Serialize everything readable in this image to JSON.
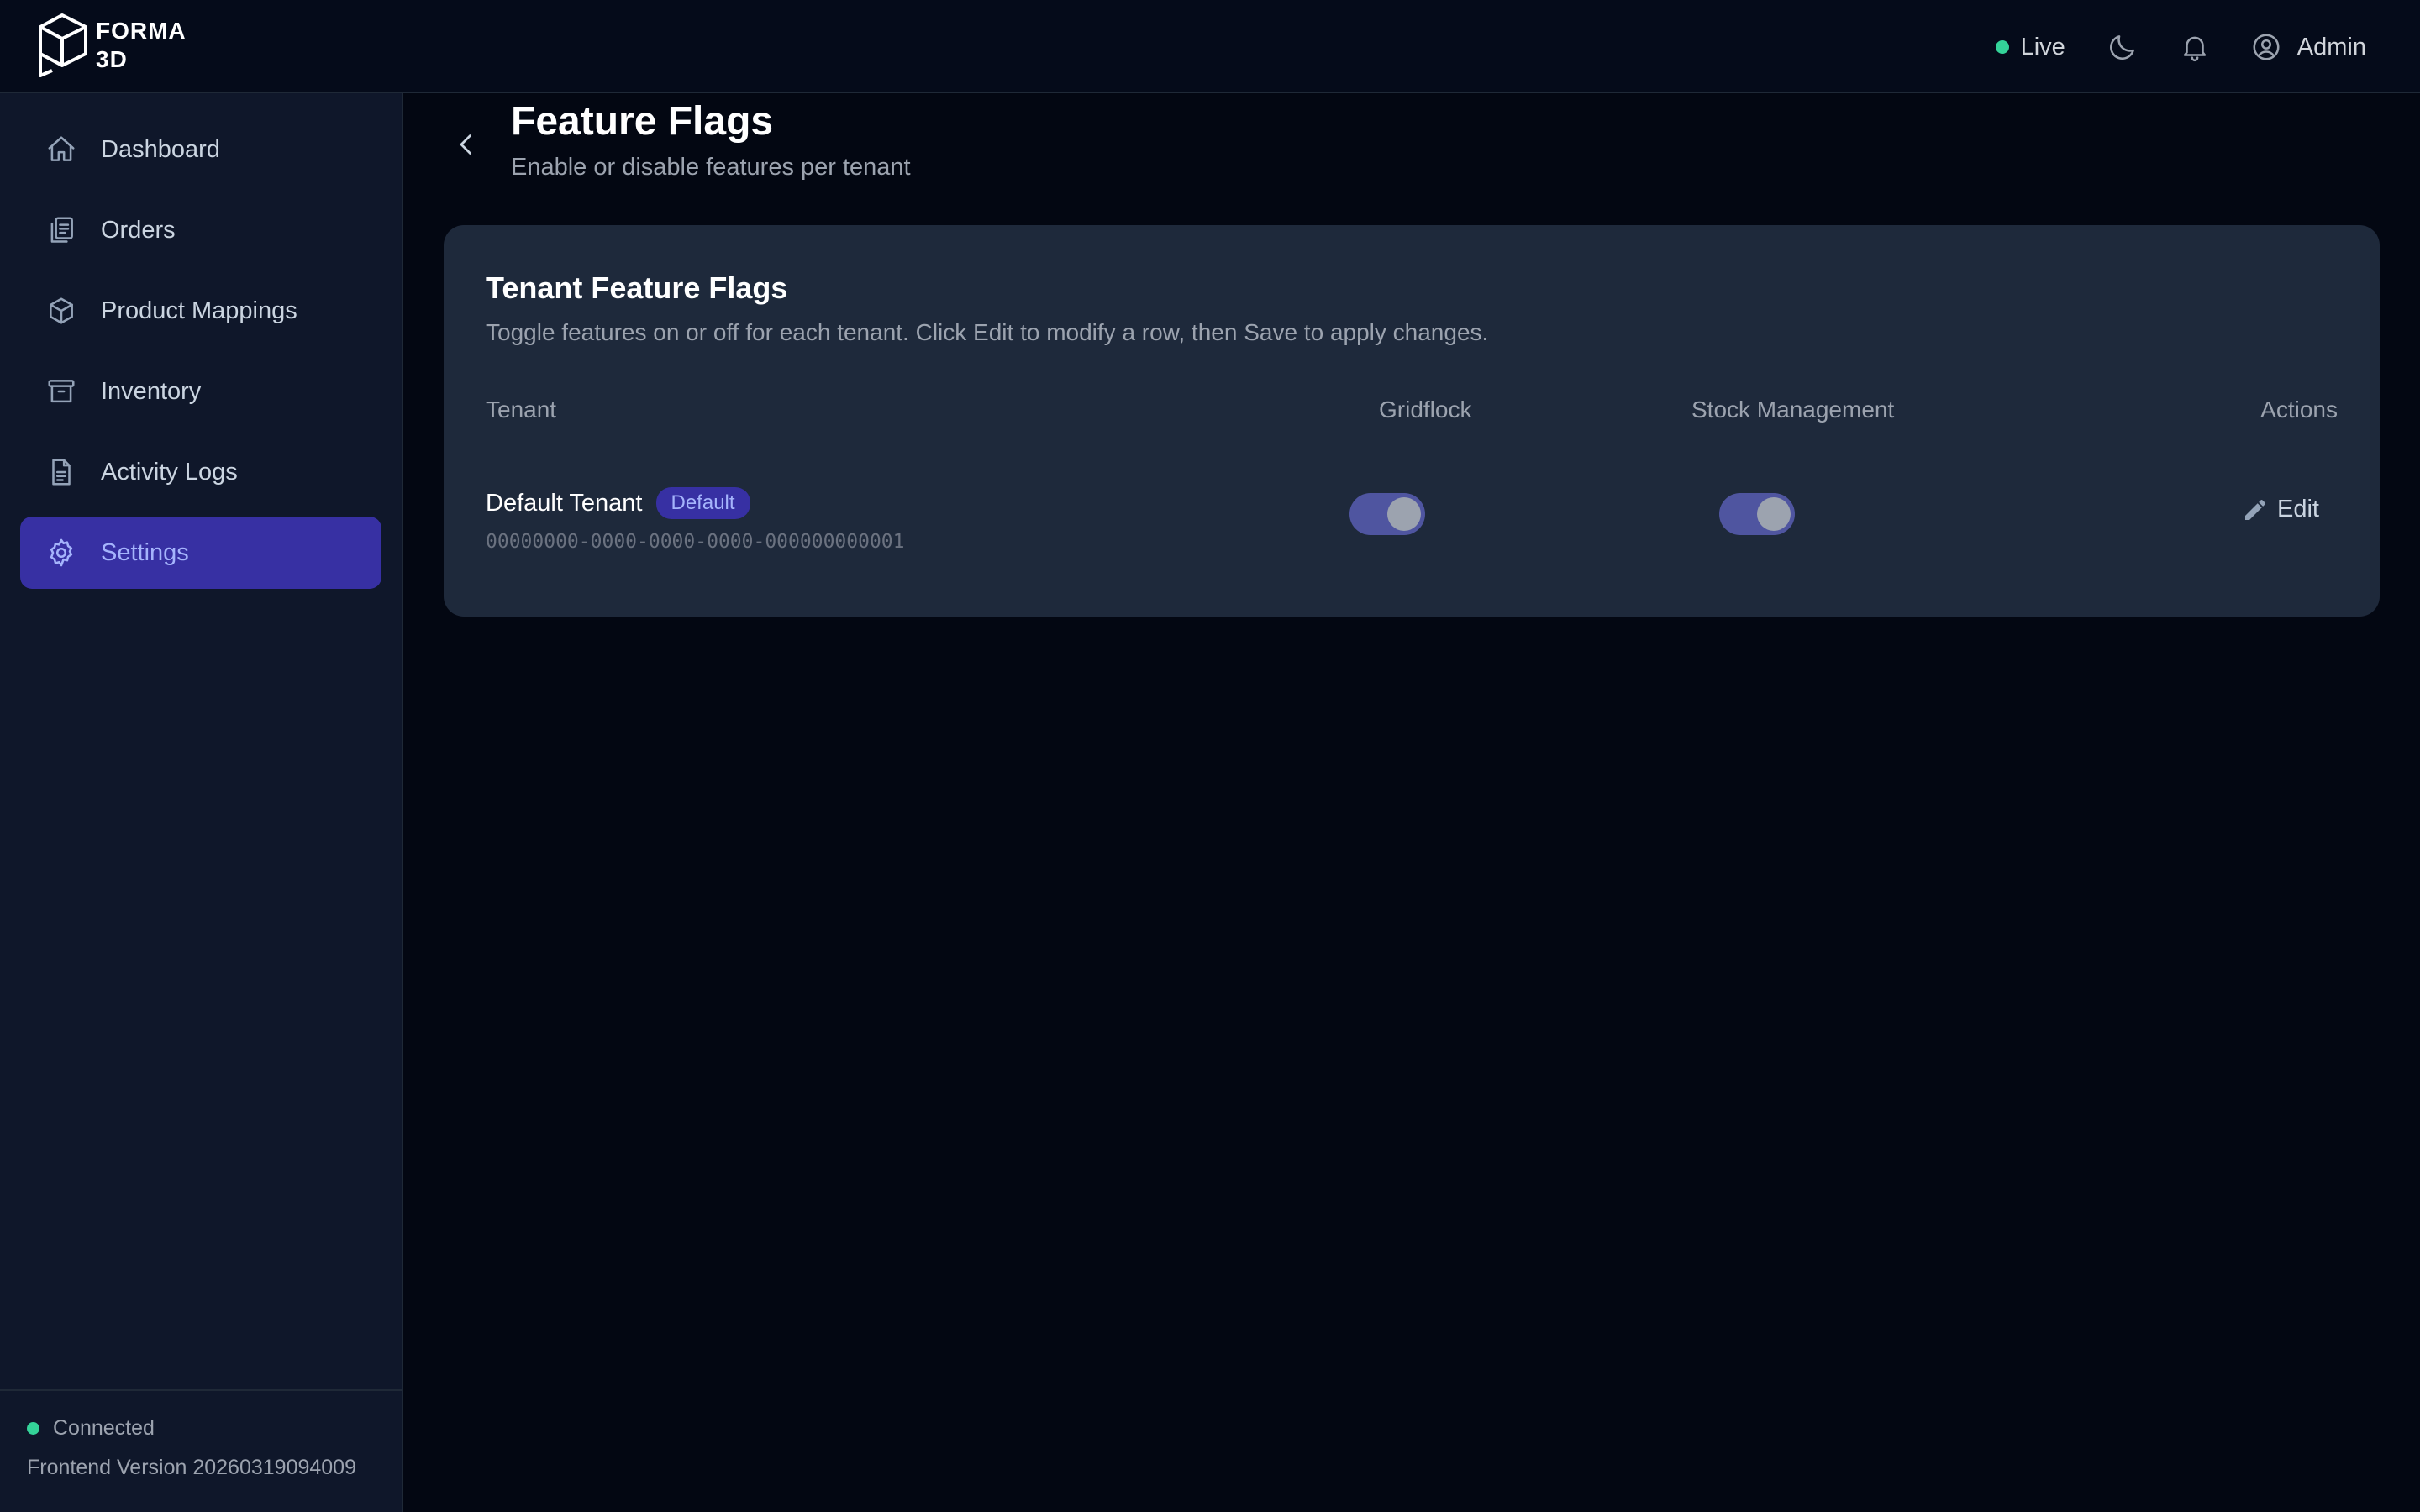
{
  "app": {
    "logo_line1": "FORMA",
    "logo_line2": "3D"
  },
  "header": {
    "status": "Live",
    "user": "Admin",
    "icons": [
      "moon-icon",
      "bell-icon",
      "user-circle-icon"
    ]
  },
  "sidebar": {
    "items": [
      {
        "label": "Dashboard",
        "icon": "home-icon"
      },
      {
        "label": "Orders",
        "icon": "clipboard-icon"
      },
      {
        "label": "Product Mappings",
        "icon": "cube-icon"
      },
      {
        "label": "Inventory",
        "icon": "archive-box-icon"
      },
      {
        "label": "Activity Logs",
        "icon": "document-icon"
      },
      {
        "label": "Settings",
        "icon": "gear-icon",
        "active": true
      }
    ],
    "connection": "Connected",
    "version": "Frontend Version 20260319094009"
  },
  "page": {
    "title": "Feature Flags",
    "subtitle": "Enable or disable features per tenant"
  },
  "card": {
    "title": "Tenant Feature Flags",
    "description": "Toggle features on or off for each tenant. Click Edit to modify a row, then Save to apply changes.",
    "columns": [
      "Tenant",
      "Gridflock",
      "Stock Management",
      "Actions"
    ],
    "rows": [
      {
        "name": "Default Tenant",
        "badge": "Default",
        "id": "00000000-0000-0000-0000-000000000001",
        "gridflock": true,
        "stock_management": true,
        "action": "Edit"
      }
    ]
  },
  "colors": {
    "background": "#030712",
    "sidebar": "#0f172a",
    "card": "#1e293b",
    "accent": "#3730a3",
    "accent_text": "#a5b4fc",
    "status_green": "#34d399"
  }
}
